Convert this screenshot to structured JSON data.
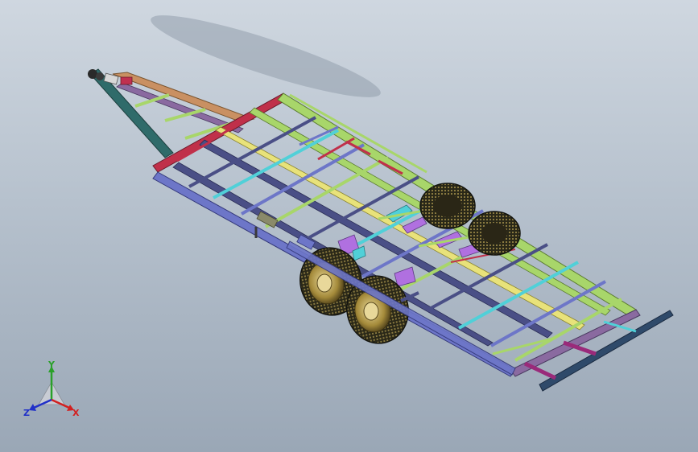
{
  "viewport": {
    "background_top": "#cfd7e0",
    "background_bottom": "#9aa7b6",
    "model_name": "car-trailer-assembly"
  },
  "triad": {
    "x_label": "X",
    "y_label": "Y",
    "z_label": "Z",
    "x_color": "#d22020",
    "y_color": "#2aa02a",
    "z_color": "#2030c8"
  },
  "colors": {
    "frame_dark": "#4a4f86",
    "frame_blue": "#6d76c8",
    "green": "#a8d66a",
    "cyan": "#50d0d8",
    "magenta": "#9a2a7a",
    "red": "#c0304a",
    "tan": "#c99062",
    "yellow": "#e8e27a",
    "tire": "#1e1e16",
    "rim": "#a48a3a",
    "purple": "#b070e0"
  }
}
